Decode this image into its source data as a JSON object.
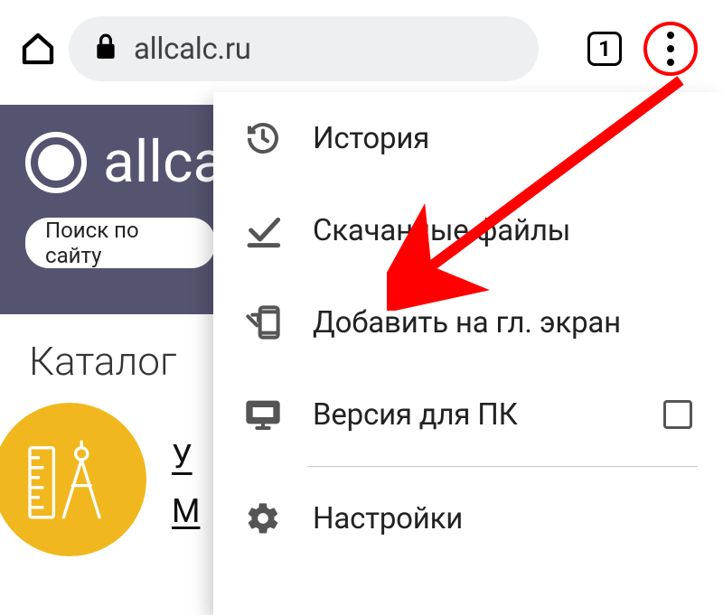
{
  "toolbar": {
    "url": "allcalc.ru",
    "tab_count": "1"
  },
  "page": {
    "site_name": "allca",
    "search_placeholder": "Поиск по сайту",
    "catalog_heading": "Каталог",
    "catalog_line1": "У",
    "catalog_line2": "М"
  },
  "menu": {
    "items": [
      {
        "label": "История"
      },
      {
        "label": "Скачанные файлы"
      },
      {
        "label": "Добавить на гл. экран"
      },
      {
        "label": "Версия для ПК"
      },
      {
        "label": "Настройки"
      }
    ]
  }
}
